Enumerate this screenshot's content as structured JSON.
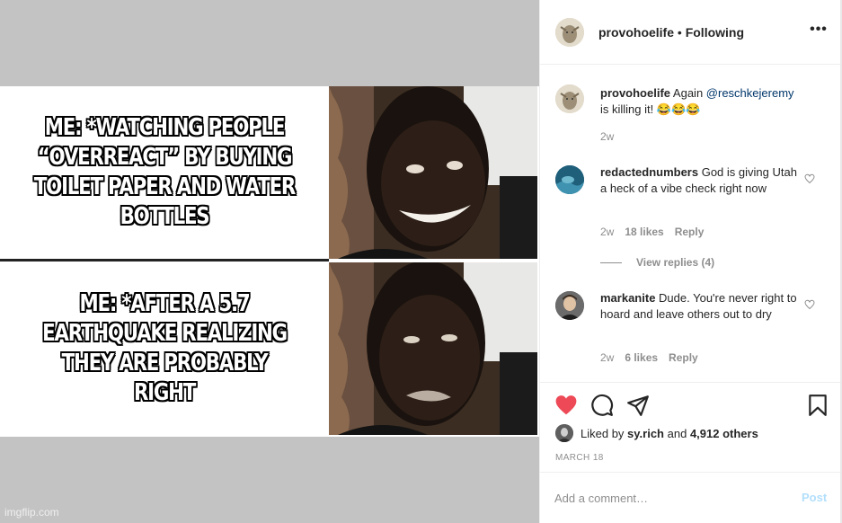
{
  "meme": {
    "top_caption": "ME: *WATCHING PEOPLE “OVERREACT” BY BUYING TOILET PAPER AND WATER BOTTLES",
    "bottom_caption": "ME: *AFTER A 5.7 EARTHQUAKE REALIZING THEY ARE PROBABLY RIGHT",
    "watermark": "imgflip.com"
  },
  "header": {
    "username": "provohoelife",
    "separator": " • ",
    "follow_status": "Following",
    "more_icon": "more-horizontal-icon",
    "more_label": "•••"
  },
  "caption": {
    "username": "provohoelife",
    "text": "Again",
    "mention": "@reschkejeremy",
    "text_after": "is killing it! 😂😂😂",
    "time": "2w"
  },
  "comments": [
    {
      "username": "redactednumbers",
      "text": "God is giving Utah a heck of a vibe check right now",
      "time": "2w",
      "likes": "18 likes",
      "reply_label": "Reply",
      "view_replies": "View replies (4)"
    },
    {
      "username": "markanite",
      "text": "Dude. You're never right to hoard and leave others out to dry",
      "time": "2w",
      "likes": "6 likes",
      "reply_label": "Reply"
    }
  ],
  "actions": {
    "like_icon": "heart-filled-icon",
    "comment_icon": "comment-icon",
    "share_icon": "share-icon",
    "save_icon": "bookmark-icon",
    "liked_prefix": "Liked by",
    "liked_user": "sy.rich",
    "liked_and": "and",
    "liked_others": "4,912 others",
    "date": "MARCH 18"
  },
  "add_comment": {
    "placeholder": "Add a comment…",
    "post_label": "Post"
  },
  "colors": {
    "like_red": "#ed4956",
    "text": "#262626",
    "muted": "#8e8e8e",
    "post_disabled": "#b2dffc",
    "mention": "#00376b"
  }
}
